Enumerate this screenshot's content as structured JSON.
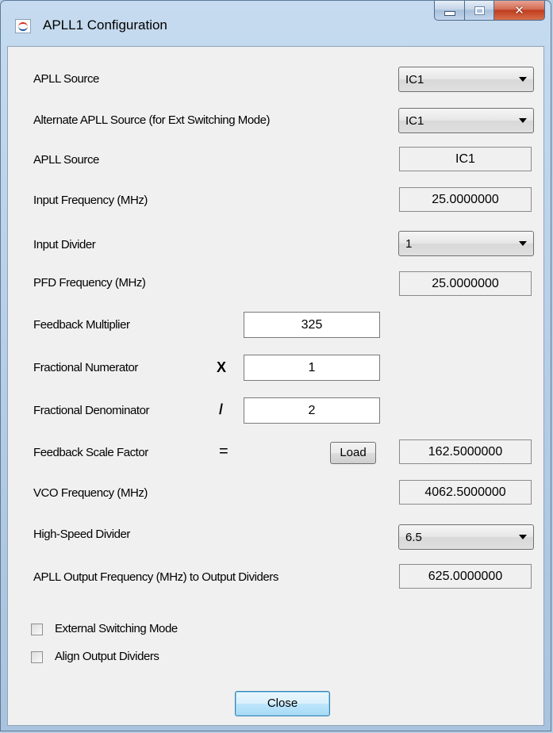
{
  "window": {
    "title": "APLL1 Configuration"
  },
  "rows": {
    "apll_source": {
      "label": "APLL Source",
      "value": "IC1"
    },
    "alt_apll_source": {
      "label": "Alternate APLL Source (for Ext Switching Mode)",
      "value": "IC1"
    },
    "apll_source_ro": {
      "label": "APLL Source",
      "value": "IC1"
    },
    "input_frequency": {
      "label": "Input Frequency (MHz)",
      "value": "25.0000000"
    },
    "input_divider": {
      "label": "Input Divider",
      "value": "1"
    },
    "pfd_frequency": {
      "label": "PFD Frequency (MHz)",
      "value": "25.0000000"
    },
    "feedback_multiplier": {
      "label": "Feedback Multiplier",
      "value": "325"
    },
    "fractional_numerator": {
      "label": "Fractional Numerator",
      "op": "X",
      "value": "1"
    },
    "fractional_denominator": {
      "label": "Fractional Denominator",
      "op": "/",
      "value": "2"
    },
    "feedback_scale_factor": {
      "label": "Feedback Scale Factor",
      "op": "=",
      "button": "Load",
      "value": "162.5000000"
    },
    "vco_frequency": {
      "label": "VCO Frequency (MHz)",
      "value": "4062.5000000"
    },
    "high_speed_divider": {
      "label": "High-Speed Divider",
      "value": "6.5"
    },
    "apll_output_frequency": {
      "label": "APLL Output Frequency (MHz) to Output Dividers",
      "value": "625.0000000"
    }
  },
  "options": {
    "external_switching": {
      "label": "External Switching Mode",
      "checked": false
    },
    "align_output_dividers": {
      "label": "Align Output Dividers",
      "checked": false
    }
  },
  "footer": {
    "close_label": "Close"
  }
}
